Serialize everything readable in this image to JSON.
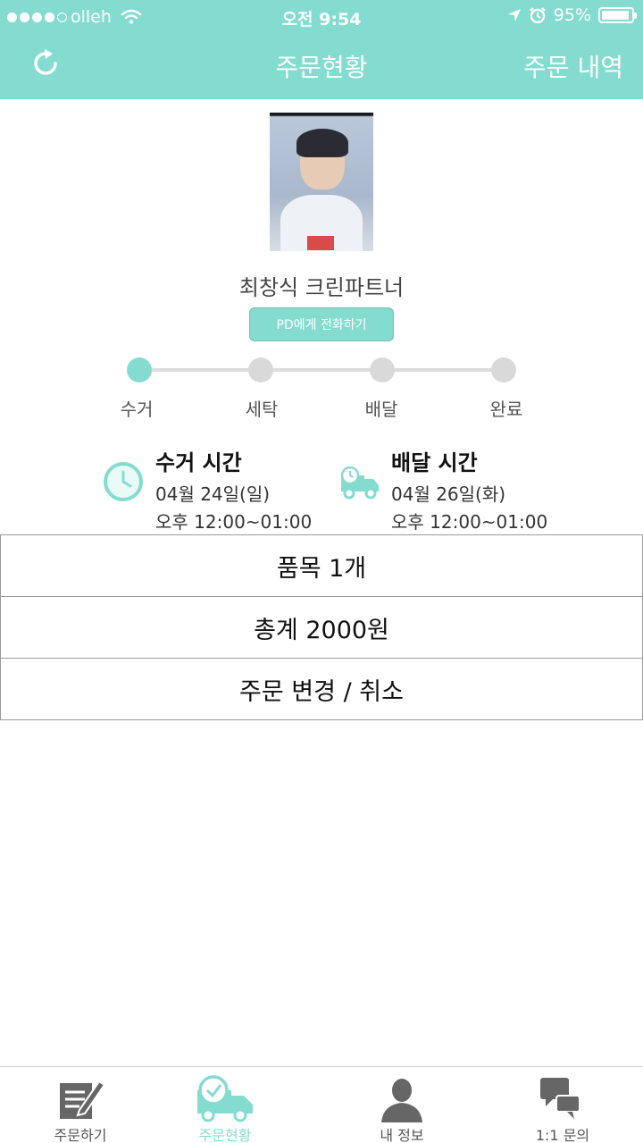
{
  "status_bar": {
    "carrier": "olleh",
    "time": "오전 9:54",
    "battery": "95%",
    "battery_level": 0.95
  },
  "header": {
    "title": "주문현황",
    "right_action": "주문 내역",
    "left_icon": "refresh-icon"
  },
  "profile": {
    "name": "최창식 크린파트너",
    "call_button": "PD에게 전화하기"
  },
  "steps": {
    "current_index": 0,
    "items": [
      "수거",
      "세탁",
      "배달",
      "완료"
    ]
  },
  "pickup": {
    "title": "수거 시간",
    "date": "04월 24일(일)",
    "time": "오후 12:00~01:00",
    "icon": "clock-icon"
  },
  "delivery": {
    "title": "배달 시간",
    "date": "04월 26일(화)",
    "time": "오후 12:00~01:00",
    "icon": "truck-icon"
  },
  "rows": {
    "items_count": "품목 1개",
    "total": "총계 2000원",
    "modify_cancel": "주문 변경 / 취소"
  },
  "tabbar": {
    "active_index": 1,
    "items": [
      {
        "label": "주문하기",
        "icon": "order-form-icon"
      },
      {
        "label": "주문현황",
        "icon": "delivery-status-icon"
      },
      {
        "label": "내 정보",
        "icon": "user-profile-icon"
      },
      {
        "label": "1:1 문의",
        "icon": "chat-bubbles-icon"
      }
    ]
  },
  "colors": {
    "accent": "#84dcd0",
    "inactive_step": "#d9d9d9",
    "icon_gray": "#666666"
  }
}
